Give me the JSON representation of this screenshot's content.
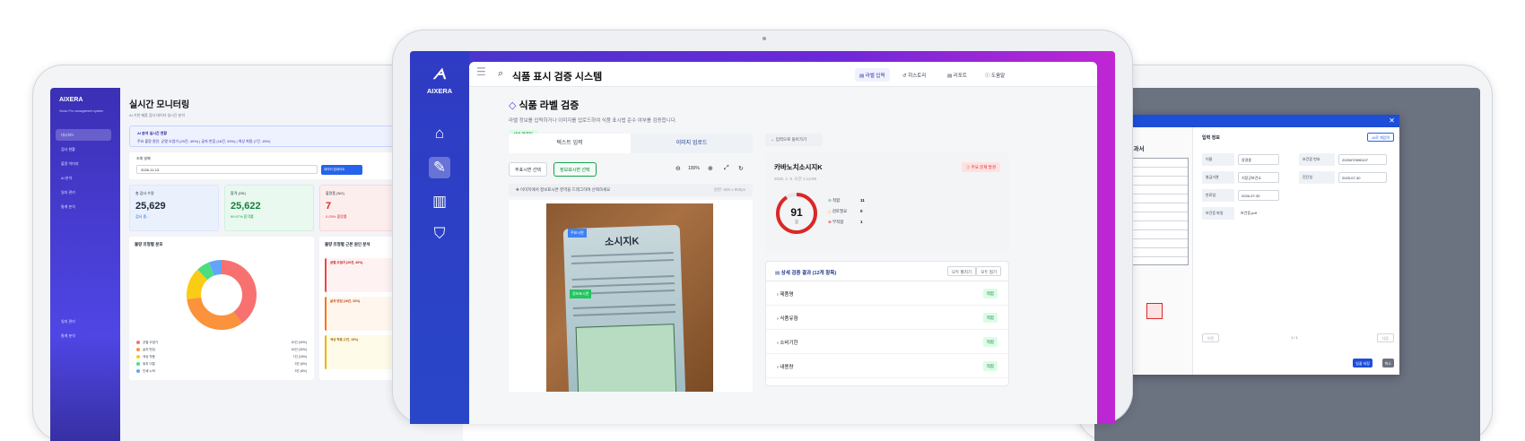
{
  "left_app": {
    "logo": "AIXERA",
    "subtitle": "Vision Pro management system",
    "nav": [
      "대시보드",
      "검사 현황",
      "불량 이미지",
      "AI 분석",
      "일지 관리",
      "통계 분석"
    ],
    "nav_bottom": [
      "일지 관리",
      "통계 분석"
    ],
    "title": "실시간 모니터링",
    "page_sub": "AI 기반 제품 검사 데이터 실시간 분석",
    "banner_title": "AI 분석 실시간 현황",
    "banner_text": "주요 불량 원인: 균열 오염기 (20건, 40%) | 글자 번짐 (16건, 33%) | 색상 착용 (7건, 15%)",
    "date_label": "조회 날짜",
    "date_value": "2026-11-13",
    "refresh_button": "데이터 업데이트",
    "kpis": [
      {
        "label": "총 검사 수량",
        "value": "25,629",
        "note": "검사 중..."
      },
      {
        "label": "합격 (OK)",
        "value": "25,622",
        "note": "99.97% 합격률"
      },
      {
        "label": "불량품 (NG)",
        "value": "7",
        "note": "0.03% 불량률"
      }
    ],
    "donut_title": "불량 유형별 분포",
    "donut_legend": [
      {
        "name": "균열 오염기",
        "value": "20건 (40%)",
        "color": "#f87171"
      },
      {
        "name": "글자 번짐",
        "value": "16건 (33%)",
        "color": "#fb923c"
      },
      {
        "name": "색상 착용",
        "value": "7건 (15%)",
        "color": "#facc15"
      },
      {
        "name": "위치 이탈",
        "value": "3건 (6%)",
        "color": "#4ade80"
      },
      {
        "name": "인쇄 누락",
        "value": "3건 (6%)",
        "color": "#60a5fa"
      }
    ],
    "cause_title": "불량 유형별 근본 원인 분석",
    "causes": [
      {
        "title": "균열 오염기 (20건, 40%)",
        "color": "#ef4444",
        "bg": "#fef2f2"
      },
      {
        "title": "글자 번짐 (16건, 33%)",
        "color": "#f97316",
        "bg": "#fff7ed"
      },
      {
        "title": "색상 착용 (7건, 15%)",
        "color": "#eab308",
        "bg": "#fefce8"
      }
    ]
  },
  "center_app": {
    "logo": "AIXERA",
    "title": "식품 표시 검증 시스템",
    "top_nav": [
      "라벨 입력",
      "히스토리",
      "리포트",
      "도움말"
    ],
    "page_title": "식품 라벨 검증",
    "page_sub": "라벨 정보를 입력하거나 이미지를 업로드하여 식품 표시법 준수 여부를 검증합니다.",
    "server_status": "서버 연결됨",
    "tabs": [
      "텍스트 입력",
      "이미지 업로드"
    ],
    "tool_buttons": [
      "주표시면 선택",
      "정보표시면 선택"
    ],
    "zoom": "100%",
    "hint": "이미지에서 정보표시면 영역을 드래그하여 선택하세요",
    "hint_size": "원본: 600 x 800px",
    "photo_badges": [
      "주표시면",
      "정보표시면"
    ],
    "product_brand": "소시지K",
    "back_button": "입력으로 돌아가기",
    "product_name": "카바노치소시지K",
    "product_date": "2026. 1. 9. 오전 1:13:09",
    "issue_badge": "주요 문제 발견",
    "score": 91,
    "score_unit": "점",
    "stats": [
      {
        "label": "적합",
        "value": "11",
        "color": "#16a34a"
      },
      {
        "label": "검토필요",
        "value": "0",
        "color": "#f59e0b"
      },
      {
        "label": "부적합",
        "value": "1",
        "color": "#dc2626"
      }
    ],
    "detail_title": "상세 검증 결과 (12개 항목)",
    "expand_all": "모두 펼치기",
    "collapse_all": "모두 접기",
    "items": [
      {
        "name": "제품명",
        "status": "적합"
      },
      {
        "name": "식품유형",
        "status": "적합"
      },
      {
        "name": "소비기한",
        "status": "적합"
      },
      {
        "name": "내용량",
        "status": "적합"
      }
    ]
  },
  "right_app": {
    "doc_title": "시 건강진단 결과서",
    "doc_stamp": "건소장",
    "form_title": "입력 정보",
    "ai_button": "AI로 재입력",
    "fields": [
      {
        "label": "이름",
        "value": "양경용"
      },
      {
        "label": "발급기관",
        "value": "기장군보건소"
      },
      {
        "label": "만료일",
        "value": "2026-07-30"
      },
      {
        "label": "보건증 파일",
        "value": "보건증.pdf"
      }
    ],
    "fields_right": [
      {
        "label": "보건증 번호",
        "value": "2025070590107"
      },
      {
        "label": "진단일",
        "value": "2025-07-30"
      }
    ],
    "pager": "1 / 1",
    "prev_button": "이전",
    "next_button": "다음",
    "save_button": "일괄 저장",
    "cancel_button": "취소"
  }
}
